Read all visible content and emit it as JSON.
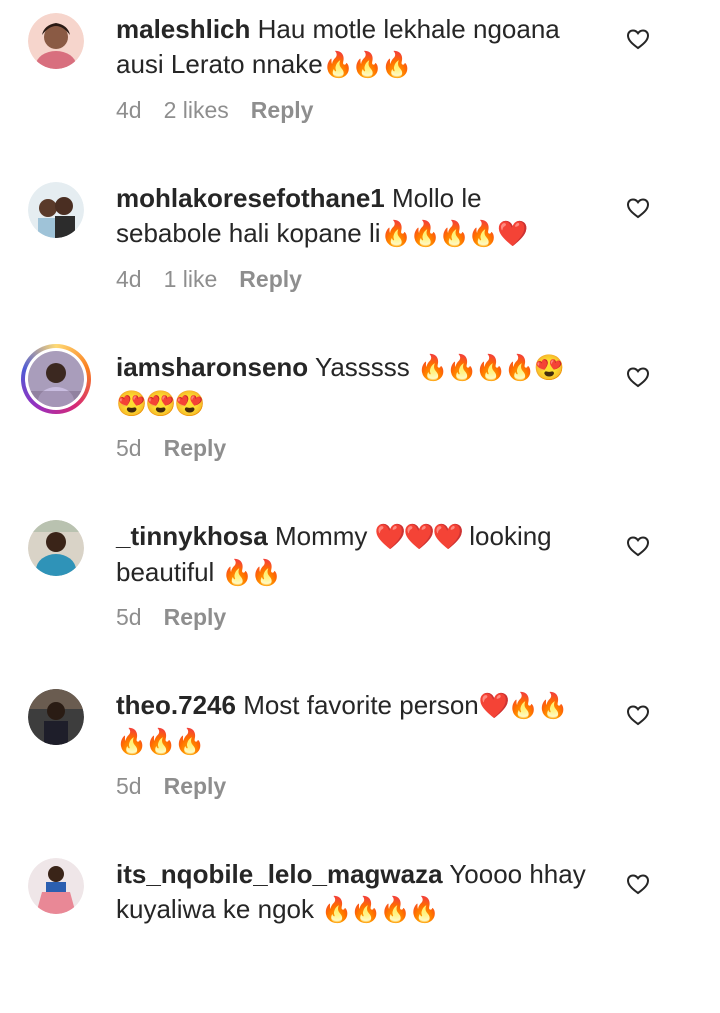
{
  "comments": [
    {
      "username": "maleshlich",
      "text": "Hau motle lekhale ngoana ausi Lerato nnake",
      "emojis": "🔥🔥🔥",
      "time": "4d",
      "likes": "2 likes",
      "reply": "Reply",
      "avatar_bg": "#f2c9c0"
    },
    {
      "username": "mohlakoresefothane1",
      "text": "Mollo le sebabole hali kopane li",
      "emojis": "🔥🔥🔥🔥❤️",
      "time": "4d",
      "likes": "1 like",
      "reply": "Reply",
      "avatar_bg": "#d7e3ea"
    },
    {
      "username": "iamsharonseno",
      "text": "Yasssss",
      "emojis": "🔥🔥🔥🔥😍😍😍😍",
      "time": "5d",
      "likes": "",
      "reply": "Reply",
      "avatar_bg": "#bcb0c8"
    },
    {
      "username": "_tinnykhosa",
      "text": "Mommy",
      "text_hearts": "❤️❤️❤️",
      "text2": "looking beautiful",
      "emojis": "🔥🔥",
      "time": "5d",
      "likes": "",
      "reply": "Reply",
      "avatar_bg": "#3a8fb0"
    },
    {
      "username": "theo.7246",
      "text": "Most favorite person",
      "emojis": "❤️🔥🔥🔥🔥🔥",
      "time": "5d",
      "likes": "",
      "reply": "Reply",
      "avatar_bg": "#4a4a4a"
    },
    {
      "username": "its_nqobile_lelo_magwaza",
      "text": "Yoooo hhay kuyaliwa ke ngok",
      "emojis": "🔥🔥🔥🔥",
      "time": "",
      "likes": "",
      "reply": "",
      "avatar_bg": "#e9a0a8"
    }
  ],
  "icons": {
    "like": "heart-outline-icon"
  }
}
